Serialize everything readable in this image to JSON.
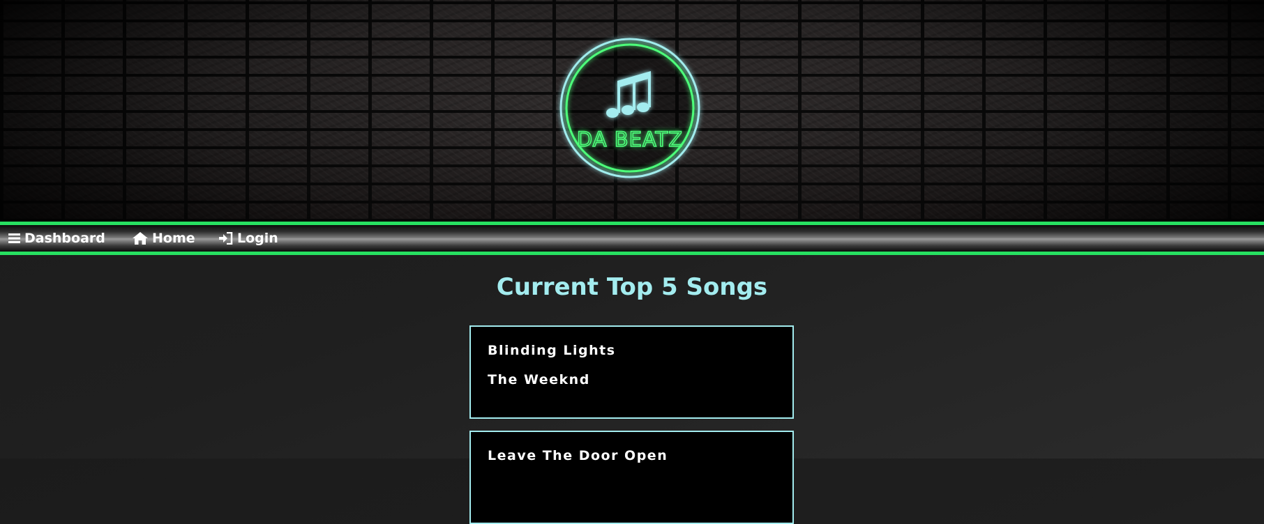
{
  "brand": {
    "name": "DA BEATZ",
    "icon": "music-notes-icon",
    "glow_color": "#4dff7a",
    "ring_color": "#a3ecef"
  },
  "nav": {
    "items": [
      {
        "label": "Dashboard",
        "icon": "hamburger-menu-icon"
      },
      {
        "label": "Home",
        "icon": "house-icon"
      },
      {
        "label": "Login",
        "icon": "sign-in-icon"
      }
    ],
    "accent": "#27e061"
  },
  "main": {
    "title": "Current Top 5 Songs",
    "songs": [
      {
        "title": "Blinding Lights",
        "artist": "The Weeknd"
      },
      {
        "title": "Leave The Door Open"
      }
    ]
  },
  "colors": {
    "title": "#a3ecef",
    "card_border": "#a3ecef",
    "card_bg": "#000000"
  }
}
